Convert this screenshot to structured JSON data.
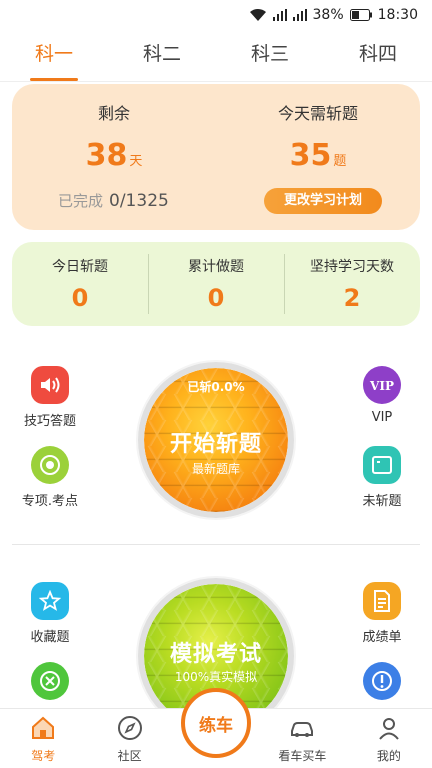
{
  "status_bar": {
    "battery": "38%",
    "time": "18:30"
  },
  "tabs": [
    {
      "label": "科一",
      "active": true
    },
    {
      "label": "科二",
      "active": false
    },
    {
      "label": "科三",
      "active": false
    },
    {
      "label": "科四",
      "active": false
    }
  ],
  "plan": {
    "remaining_label": "剩余",
    "remaining_value": "38",
    "remaining_unit": "天",
    "today_label": "今天需斩题",
    "today_value": "35",
    "today_unit": "题",
    "done_label": "已完成",
    "done_value": "0/1325",
    "change_button": "更改学习计划"
  },
  "stats": [
    {
      "label": "今日斩题",
      "value": "0"
    },
    {
      "label": "累计做题",
      "value": "0"
    },
    {
      "label": "坚持学习天数",
      "value": "2"
    }
  ],
  "side_items": {
    "skill": "技巧答题",
    "special": "专项.考点",
    "vip": "VIP",
    "unanswered": "未斩题",
    "favorites": "收藏题",
    "scores": "成绩单"
  },
  "start_circle": {
    "progress": "已斩0.0%",
    "title": "开始斩题",
    "subtitle": "最新题库"
  },
  "mock_circle": {
    "title": "模拟考试",
    "subtitle": "100%真实模拟"
  },
  "bottom_nav": {
    "drive": "驾考",
    "community": "社区",
    "practice": "练车",
    "buy_car": "看车买车",
    "mine": "我的"
  },
  "colors": {
    "accent": "#f07a1a",
    "plan_bg": "#fde6cc",
    "stats_bg": "#ecf7d6"
  }
}
